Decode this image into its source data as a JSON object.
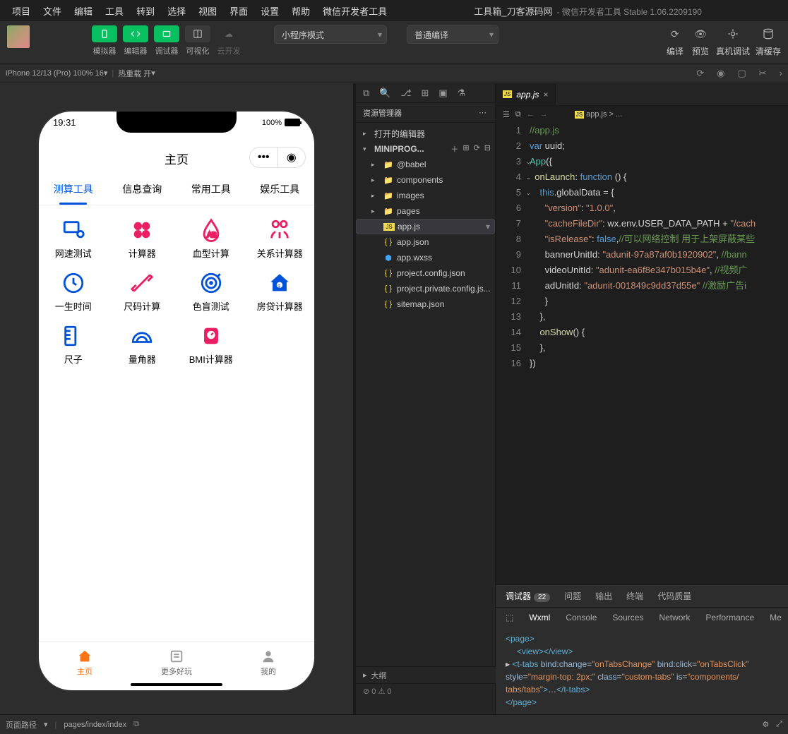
{
  "window": {
    "title": "工具箱_刀客源码网",
    "subtitle": "- 微信开发者工具 Stable 1.06.2209190"
  },
  "menubar": [
    "项目",
    "文件",
    "编辑",
    "工具",
    "转到",
    "选择",
    "视图",
    "界面",
    "设置",
    "帮助",
    "微信开发者工具"
  ],
  "toolbar": {
    "simulator": "模拟器",
    "editor": "编辑器",
    "debugger": "调试器",
    "visual": "可视化",
    "cloud": "云开发",
    "mode": "小程序模式",
    "compileMode": "普通编译",
    "compile": "编译",
    "preview": "预览",
    "realDebug": "真机调试",
    "clearCache": "清缓存"
  },
  "devbar": {
    "device": "iPhone 12/13 (Pro) 100% 16",
    "hotreload": "热重载 开"
  },
  "phone": {
    "time": "19:31",
    "battery": "100%",
    "pageTitle": "主页",
    "tabs": [
      "测算工具",
      "信息查询",
      "常用工具",
      "娱乐工具"
    ],
    "grid": [
      {
        "label": "网速测试"
      },
      {
        "label": "计算器"
      },
      {
        "label": "血型计算"
      },
      {
        "label": "关系计算器"
      },
      {
        "label": "一生时间"
      },
      {
        "label": "尺码计算"
      },
      {
        "label": "色盲测试"
      },
      {
        "label": "房贷计算器"
      },
      {
        "label": "尺子"
      },
      {
        "label": "量角器"
      },
      {
        "label": "BMI计算器"
      }
    ],
    "tabbar": {
      "home": "主页",
      "more": "更多好玩",
      "mine": "我的"
    }
  },
  "explorer": {
    "title": "资源管理器",
    "opened": "打开的编辑器",
    "project": "MINIPROG...",
    "tree": [
      {
        "name": "@babel",
        "type": "folder",
        "icon": "folder",
        "color": "#808080"
      },
      {
        "name": "components",
        "type": "folder",
        "icon": "folder",
        "color": "#66bb6a"
      },
      {
        "name": "images",
        "type": "folder",
        "icon": "folder",
        "color": "#4fb3d9"
      },
      {
        "name": "pages",
        "type": "folder",
        "icon": "folder",
        "color": "#66bb6a"
      },
      {
        "name": "app.js",
        "type": "js",
        "selected": true
      },
      {
        "name": "app.json",
        "type": "json"
      },
      {
        "name": "app.wxss",
        "type": "wxss"
      },
      {
        "name": "project.config.json",
        "type": "json"
      },
      {
        "name": "project.private.config.js...",
        "type": "json"
      },
      {
        "name": "sitemap.json",
        "type": "json"
      }
    ],
    "outline": "大纲"
  },
  "editorTab": {
    "filename": "app.js",
    "breadcrumb": "app.js > ..."
  },
  "code": {
    "l1": "//app.js",
    "l2a": "var",
    "l2b": " uuid;",
    "l3a": "App",
    "l3b": "({",
    "l4a": "onLaunch",
    "l4b": ": ",
    "l4c": "function",
    "l4d": " () {",
    "l5a": "this",
    "l5b": ".globalData = {",
    "l6a": "\"version\"",
    "l6b": ": ",
    "l6c": "\"1.0.0\"",
    "l6d": ",",
    "l7a": "\"cacheFileDir\"",
    "l7b": ": wx.env.USER_DATA_PATH + ",
    "l7c": "\"/cach",
    "l8a": "\"isRelease\"",
    "l8b": ": ",
    "l8c": "false",
    "l8d": ",",
    "l8e": "//可以网络控制 用于上架屏蔽某些",
    "l9a": "bannerUnitId: ",
    "l9b": "\"adunit-97a87af0b1920902\"",
    "l9c": ", ",
    "l9d": "//bann",
    "l10a": "videoUnitId: ",
    "l10b": "\"adunit-ea6f8e347b015b4e\"",
    "l10c": ", ",
    "l10d": "//视频广",
    "l11a": "adUnitId: ",
    "l11b": "\"adunit-001849c9dd37d55e\"",
    "l11c": " ",
    "l11d": "//激励广告i",
    "l12": "      }",
    "l13": "    },",
    "l14": "    onShow() {",
    "l14a": "onShow",
    "l14b": "() {",
    "l15": "    },",
    "l16": "})"
  },
  "debugger": {
    "tabs": {
      "t1": "调试器",
      "badge": "22",
      "t2": "问题",
      "t3": "输出",
      "t4": "终端",
      "t5": "代码质量"
    },
    "tools": [
      "Wxml",
      "Console",
      "Sources",
      "Network",
      "Performance",
      "Me"
    ]
  },
  "wxml": {
    "l1o": "<page>",
    "l2": "<view></view>",
    "l3": "<t-tabs bind:change=\"onTabsChange\" bind:click=\"onTabsClick\" style=\"margin-top: 2px;\" class=\"custom-tabs\" is=\"components/tabs/tabs\">…</t-tabs>",
    "l4": "</page>"
  },
  "errors": "⊘ 0 ⚠ 0",
  "footer": {
    "pagepath": "页面路径",
    "path": "pages/index/index"
  }
}
